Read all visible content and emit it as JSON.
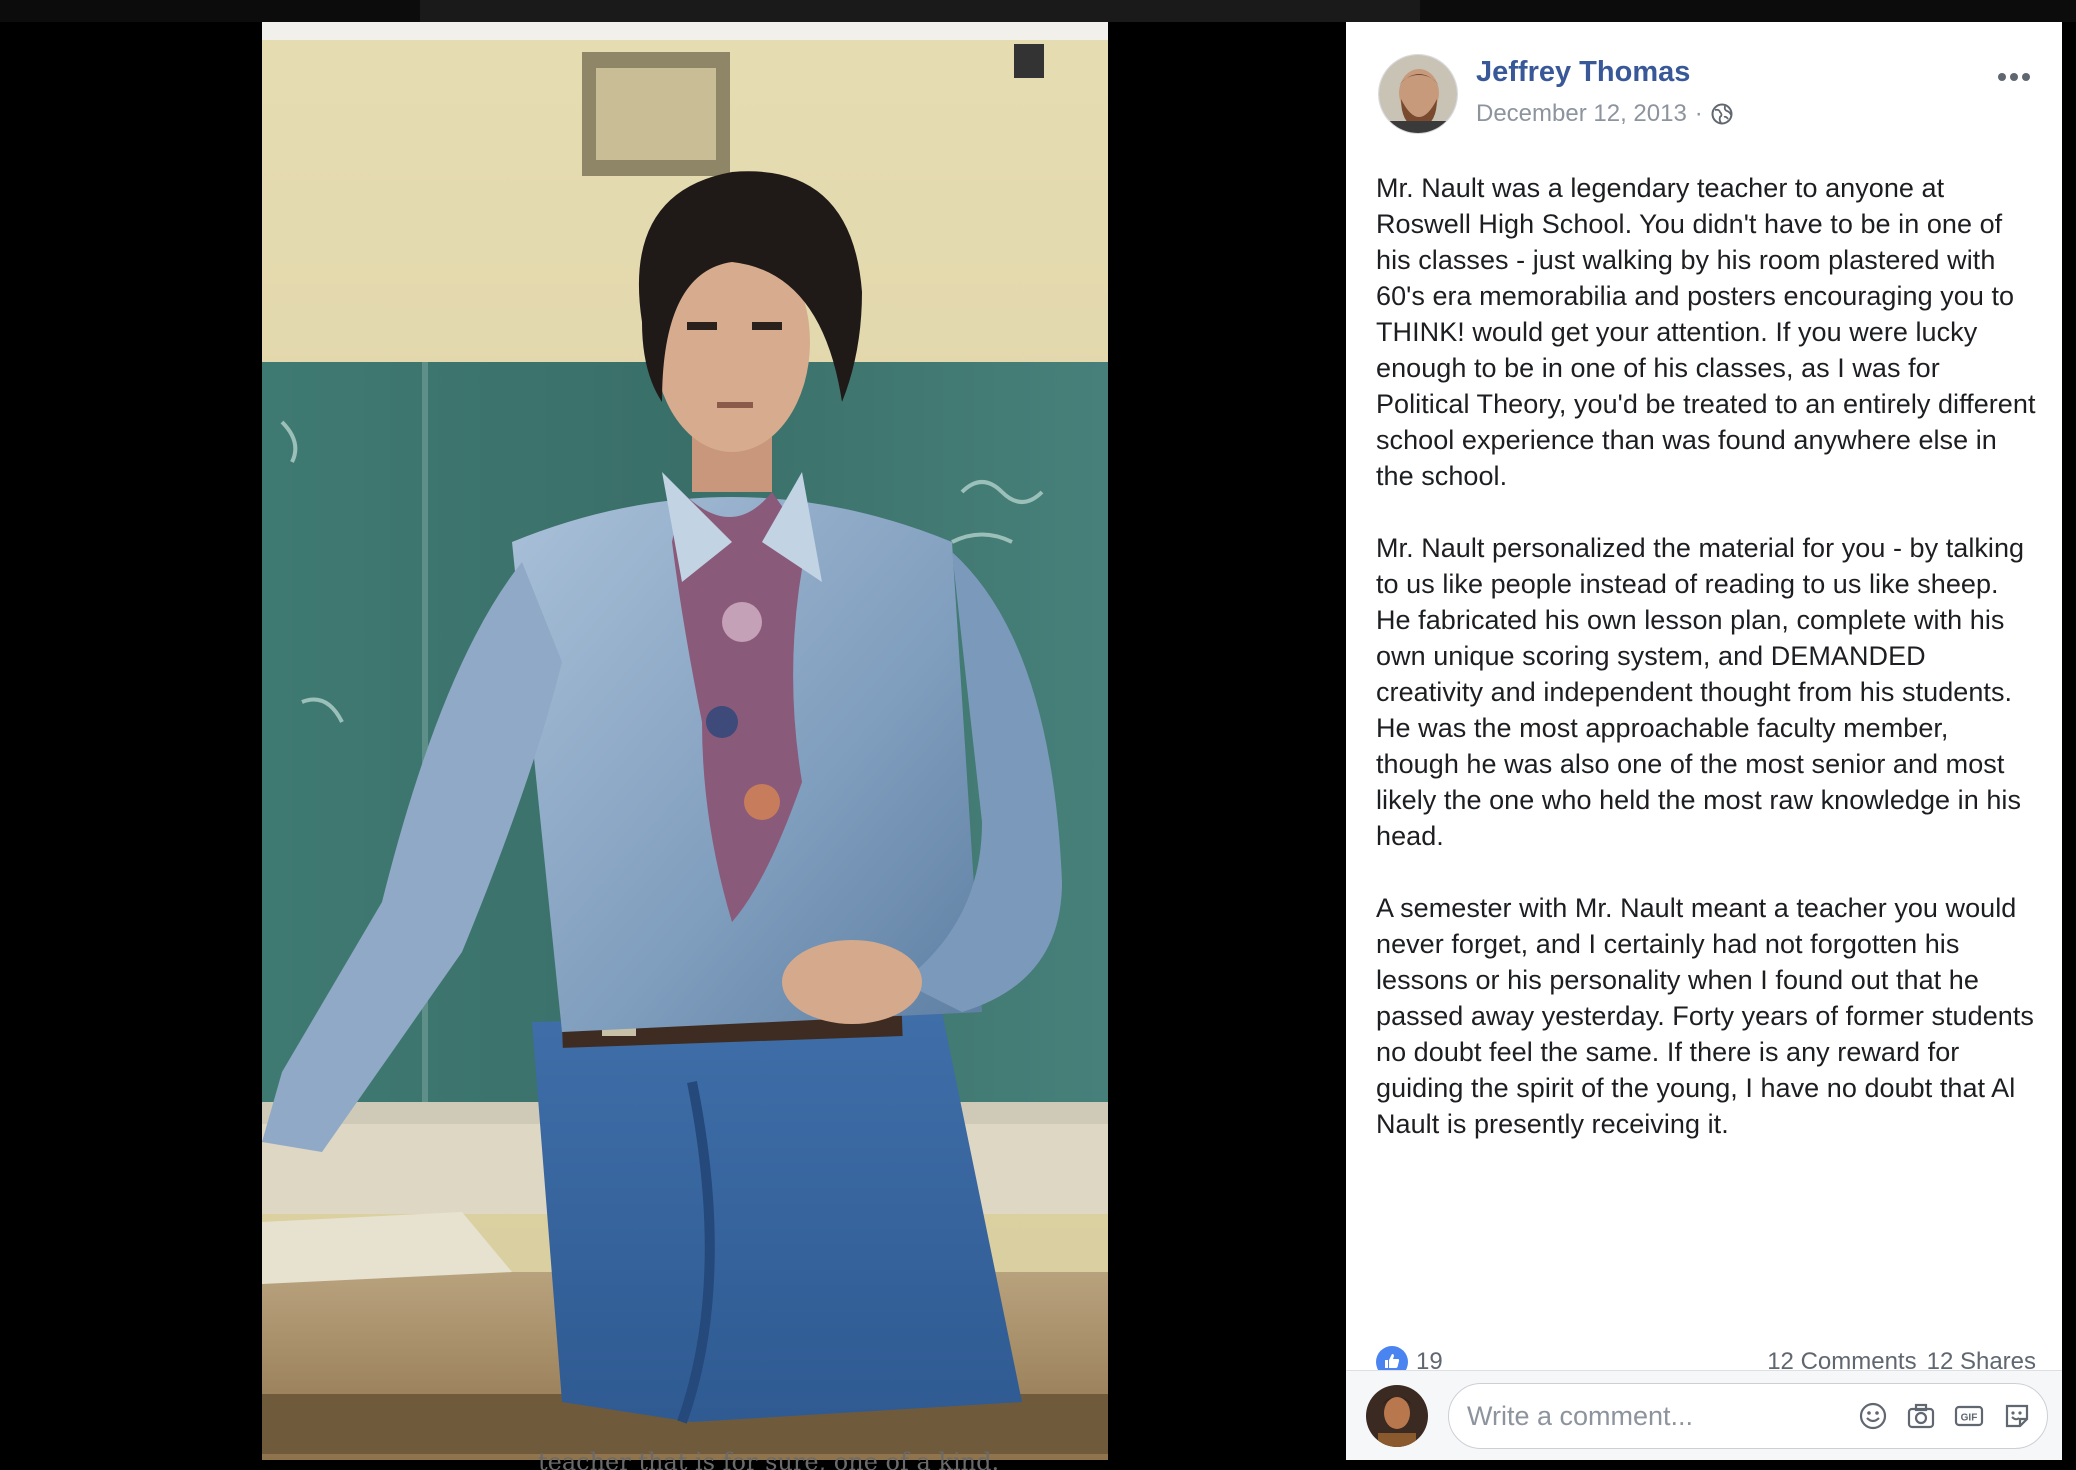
{
  "post": {
    "author": "Jeffrey Thomas",
    "date": "December 12, 2013",
    "date_separator": "·",
    "privacy_icon": "globe-icon",
    "more_icon": "more-options-icon",
    "paragraphs": [
      "Mr. Nault was a legendary teacher to anyone at Roswell High School. You didn't have to be in one of his classes - just walking by his room plastered with 60's era memorabilia and posters encouraging you to THINK! would get your attention. If you were lucky enough to be in one of his classes, as I was for Political Theory, you'd be treated to an entirely different school experience than was found anywhere else in the school.",
      "Mr. Nault personalized the material for you - by talking to us like people instead of reading to us like sheep. He fabricated his own lesson plan, complete with his own unique scoring system, and DEMANDED creativity and independent thought from his students. He was the most approachable faculty member, though he was also one of the most senior and most likely the one who held the most raw knowledge in his head.",
      "A semester with Mr. Nault meant a teacher you would never forget, and I certainly had not forgotten his lessons or his personality when I found out that he passed away yesterday. Forty years of former students no doubt feel the same. If there is any reward for guiding the spirit of the young, I have no doubt that Al Nault is presently receiving it."
    ],
    "likes": "19",
    "comments": "12 Comments",
    "shares": "12 Shares"
  },
  "composer": {
    "placeholder": "Write a comment...",
    "tools": [
      "emoji-icon",
      "camera-icon",
      "gif-icon",
      "sticker-icon"
    ]
  },
  "background_caption": "teacher that is for sure, one of a kind.",
  "colors": {
    "link_blue": "#385898",
    "like_blue": "#4a84f0",
    "secondary_text": "#8d949e",
    "body_text": "#1c1e21"
  }
}
